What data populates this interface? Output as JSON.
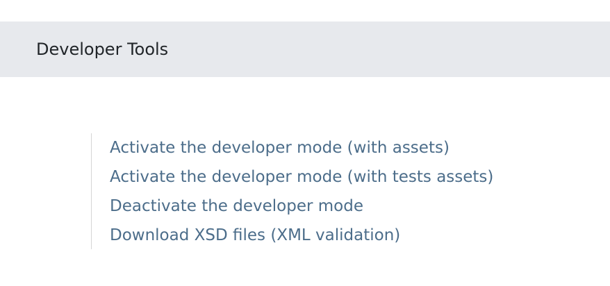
{
  "section": {
    "title": "Developer Tools"
  },
  "links": [
    "Activate the developer mode (with assets)",
    "Activate the developer mode (with tests assets)",
    "Deactivate the developer mode",
    "Download XSD files (XML validation)"
  ]
}
